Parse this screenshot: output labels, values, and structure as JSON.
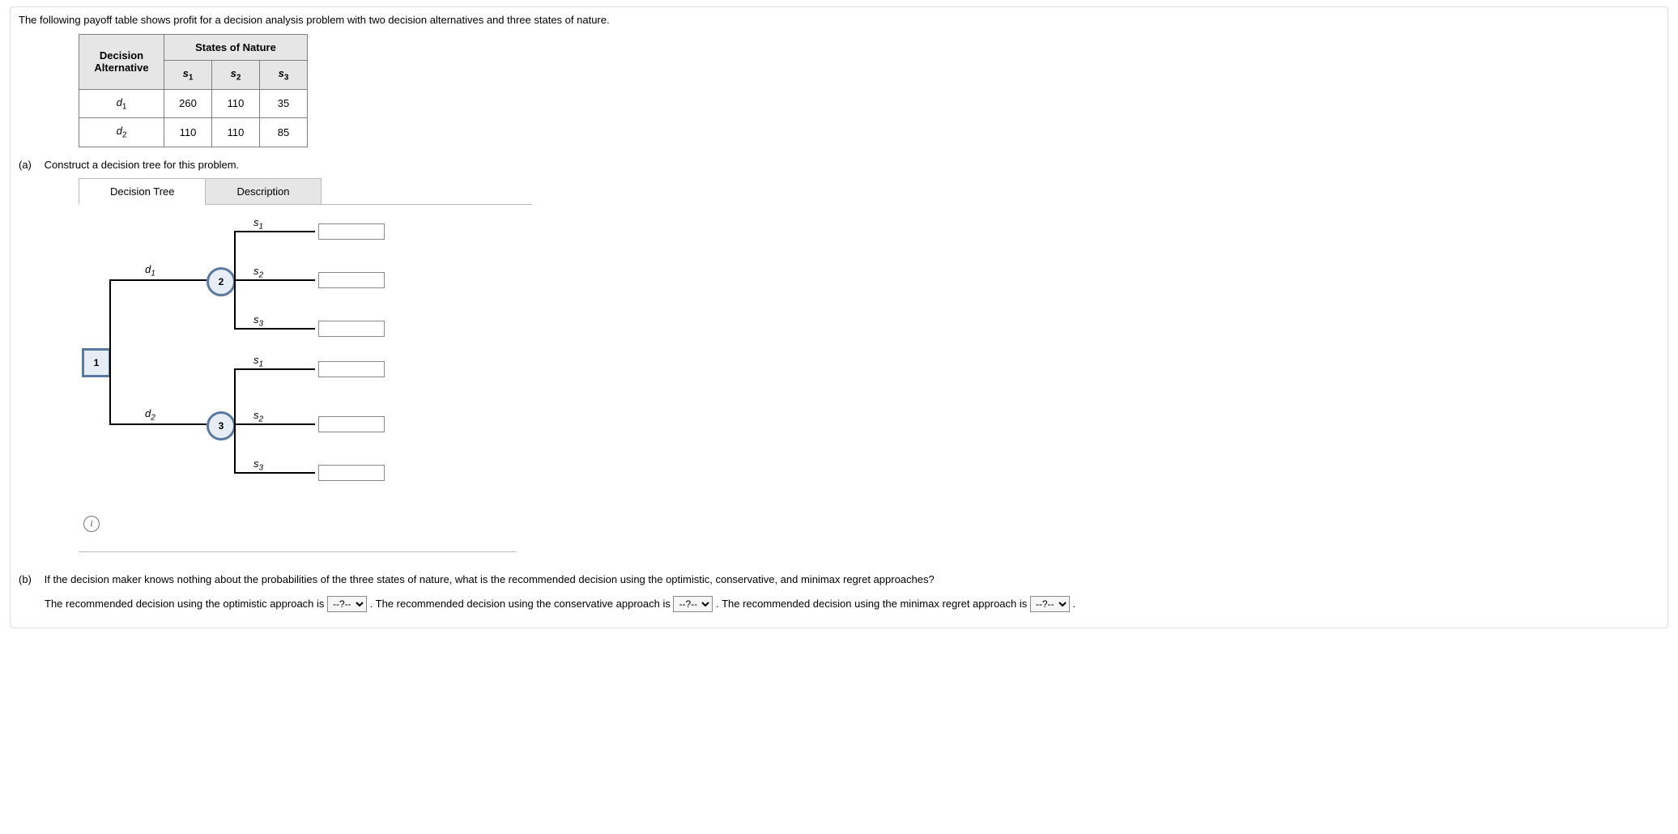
{
  "prompt": "The following payoff table shows profit for a decision analysis problem with two decision alternatives and three states of nature.",
  "table": {
    "header_decision": "Decision Alternative",
    "header_states": "States of Nature",
    "cols": {
      "s1": "s",
      "s1sub": "1",
      "s2": "s",
      "s2sub": "2",
      "s3": "s",
      "s3sub": "3"
    },
    "rows": {
      "d1": {
        "label": "d",
        "sub": "1",
        "v1": "260",
        "v2": "110",
        "v3": "35"
      },
      "d2": {
        "label": "d",
        "sub": "2",
        "v1": "110",
        "v2": "110",
        "v3": "85"
      }
    }
  },
  "parta": {
    "marker": "(a)",
    "text": "Construct a decision tree for this problem.",
    "tabs": {
      "tree": "Decision Tree",
      "desc": "Description"
    },
    "tree": {
      "node1": "1",
      "node2": "2",
      "node3": "3",
      "d1": "d",
      "d1sub": "1",
      "d2": "d",
      "d2sub": "2",
      "s1": "s",
      "s1sub": "1",
      "s2": "s",
      "s2sub": "2",
      "s3": "s",
      "s3sub": "3",
      "inputs": {
        "i1": "",
        "i2": "",
        "i3": "",
        "i4": "",
        "i5": "",
        "i6": ""
      }
    },
    "info_glyph": "i"
  },
  "chart_data": {
    "type": "table",
    "title": "Payoff table",
    "row_labels": [
      "d1",
      "d2"
    ],
    "col_labels": [
      "s1",
      "s2",
      "s3"
    ],
    "values": [
      [
        260,
        110,
        35
      ],
      [
        110,
        110,
        85
      ]
    ]
  },
  "partb": {
    "marker": "(b)",
    "question": "If the decision maker knows nothing about the probabilities of the three states of nature, what is the recommended decision using the optimistic, conservative, and minimax regret approaches?",
    "s1": "The recommended decision using the optimistic approach is ",
    "s2": ". The recommended decision using the conservative approach is ",
    "s3": ". The recommended decision using the minimax regret approach is ",
    "dd_placeholder": "--?--",
    "period": "."
  }
}
